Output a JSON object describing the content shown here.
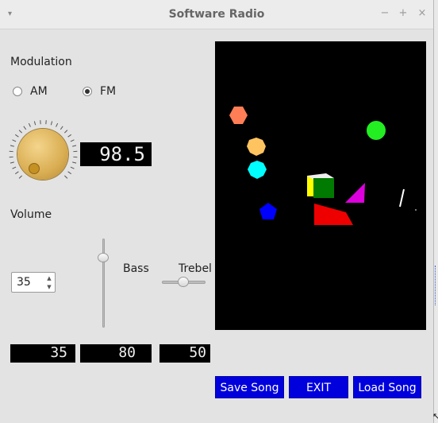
{
  "window": {
    "title": "Software Radio",
    "controls": {
      "minimize": "−",
      "maximize": "+",
      "close": "×",
      "menu": "▾"
    }
  },
  "modulation": {
    "label": "Modulation",
    "options": [
      {
        "label": "AM",
        "selected": false
      },
      {
        "label": "FM",
        "selected": true
      }
    ]
  },
  "tuner": {
    "frequency_display": "98.5"
  },
  "volume": {
    "label": "Volume",
    "spin_value": "35"
  },
  "equalizer": {
    "bass_label": "Bass",
    "treble_label": "Trebel"
  },
  "displays": {
    "volume": "35",
    "bass": "80",
    "treble": "50"
  },
  "buttons": {
    "save": "Save Song",
    "exit": "EXIT",
    "load": "Load Song"
  },
  "colors": {
    "button_bg": "#0000dd",
    "visualizer_bg": "#000000"
  }
}
